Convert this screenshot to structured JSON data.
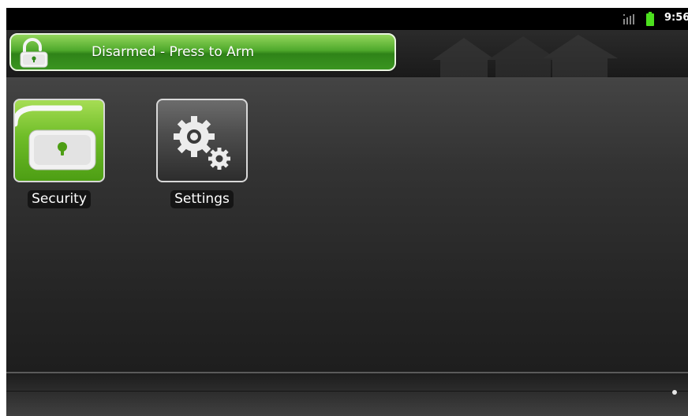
{
  "status_bar": {
    "time": "9:56",
    "signal_icon": "signal-bars-icon",
    "battery_icon": "battery-icon",
    "battery_color": "#4ce01e"
  },
  "header": {
    "arm_button": {
      "label": "Disarmed - Press to Arm",
      "icon": "unlocked-padlock-icon",
      "color": "#3a9520"
    }
  },
  "apps": [
    {
      "label": "Security",
      "icon": "unlocked-padlock-icon",
      "color": "#6fbd28"
    },
    {
      "label": "Settings",
      "icon": "gears-icon",
      "color": "#4e4e4e"
    }
  ],
  "dock": {
    "page_indicator": "dot-icon"
  }
}
